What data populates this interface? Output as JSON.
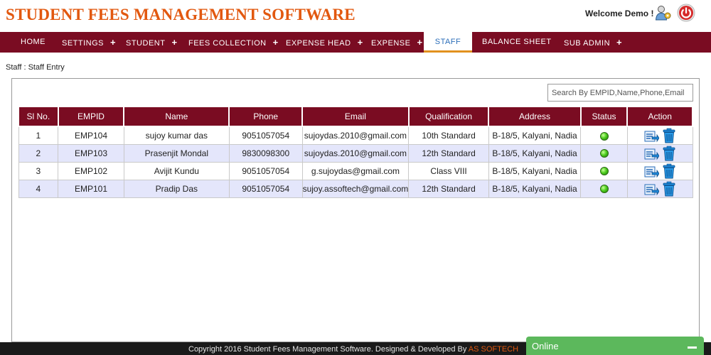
{
  "header": {
    "title": "STUDENT FEES MANAGEMENT SOFTWARE",
    "welcome": "Welcome Demo !"
  },
  "nav": {
    "items": [
      {
        "label": "HOME",
        "has_plus": false
      },
      {
        "label": "SETTINGS",
        "has_plus": true
      },
      {
        "label": "STUDENT",
        "has_plus": true
      },
      {
        "label": "FEES COLLECTION",
        "has_plus": true
      },
      {
        "label": "EXPENSE HEAD",
        "has_plus": true
      },
      {
        "label": "EXPENSE",
        "has_plus": true
      },
      {
        "label": "STAFF",
        "has_plus": false,
        "active": true
      },
      {
        "label": "BALANCE SHEET",
        "has_plus": false
      },
      {
        "label": "SUB ADMIN",
        "has_plus": true
      }
    ],
    "plus_symbol": "+"
  },
  "breadcrumb": "Staff : Staff Entry",
  "search": {
    "placeholder": "Search By EMPID,Name,Phone,Email",
    "value": ""
  },
  "table": {
    "columns": [
      "Sl No.",
      "EMPID",
      "Name",
      "Phone",
      "Email",
      "Qualification",
      "Address",
      "Status",
      "Action"
    ],
    "rows": [
      {
        "sl": "1",
        "empid": "EMP104",
        "name": "sujoy kumar das",
        "phone": "9051057054",
        "email": "sujoydas.2010@gmail.com",
        "qualification": "10th Standard",
        "address": "B-18/5, Kalyani, Nadia",
        "status": "active"
      },
      {
        "sl": "2",
        "empid": "EMP103",
        "name": "Prasenjit Mondal",
        "phone": "9830098300",
        "email": "sujoydas.2010@gmail.com",
        "qualification": "12th Standard",
        "address": "B-18/5, Kalyani, Nadia",
        "status": "active"
      },
      {
        "sl": "3",
        "empid": "EMP102",
        "name": "Avijit Kundu",
        "phone": "9051057054",
        "email": "g.sujoydas@gmail.com",
        "qualification": "Class VIII",
        "address": "B-18/5, Kalyani, Nadia",
        "status": "active"
      },
      {
        "sl": "4",
        "empid": "EMP101",
        "name": "Pradip Das",
        "phone": "9051057054",
        "email": "sujoy.assoftech@gmail.com",
        "qualification": "12th Standard",
        "address": "B-18/5, Kalyani, Nadia",
        "status": "active"
      }
    ]
  },
  "footer": {
    "text": "Copyright 2016 Student Fees Management Software. Designed & Developed By ",
    "company": "AS SOFTECH"
  },
  "chat": {
    "label": "Online"
  },
  "icons": {
    "user": "user-settings-icon",
    "power": "power-icon",
    "status": "status-active-icon",
    "edit": "edit-icon",
    "delete": "trash-icon"
  },
  "colors": {
    "brand_orange": "#e2580f",
    "nav_maroon": "#7a0c22",
    "active_tab_text": "#2a6db8",
    "row_alt": "#e4e6fb",
    "chat_green": "#5cb85c"
  }
}
